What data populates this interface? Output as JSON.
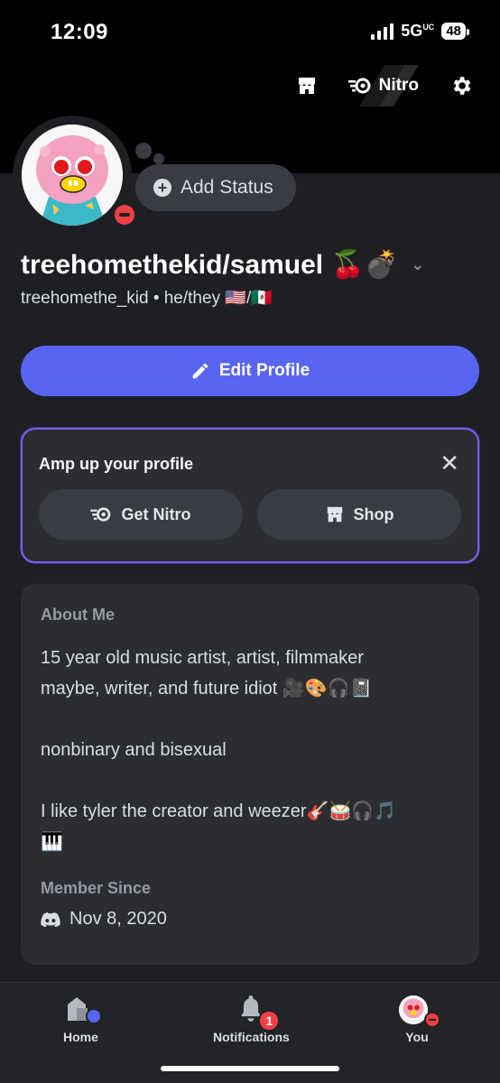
{
  "status_bar": {
    "time": "12:09",
    "network": "5G",
    "network_sup": "UC",
    "battery": "48"
  },
  "header": {
    "nitro_label": "Nitro"
  },
  "status": {
    "add_label": "Add Status"
  },
  "profile": {
    "display_name": "treehomethekid/samuel 🍒💣",
    "username_line": "treehomethe_kid • he/they 🇺🇸/🇲🇽",
    "edit_label": "Edit Profile"
  },
  "amp": {
    "title": "Amp up your profile",
    "get_nitro": "Get Nitro",
    "shop": "Shop"
  },
  "about": {
    "label": "About Me",
    "text": "15 year old music artist, artist, filmmaker\nmaybe, writer, and future idiot 🎥🎨🎧📓\n\nnonbinary and bisexual\n\nI like tyler the creator and weezer🎸🥁🎧🎵\n🎹",
    "member_label": "Member Since",
    "member_date": "Nov 8, 2020"
  },
  "nav": {
    "home": "Home",
    "notifications": "Notifications",
    "notifications_badge": "1",
    "you": "You"
  },
  "colors": {
    "accent": "#5865f2",
    "dnd": "#f23f43",
    "card": "#2b2d31",
    "bg": "#1e1f24"
  }
}
